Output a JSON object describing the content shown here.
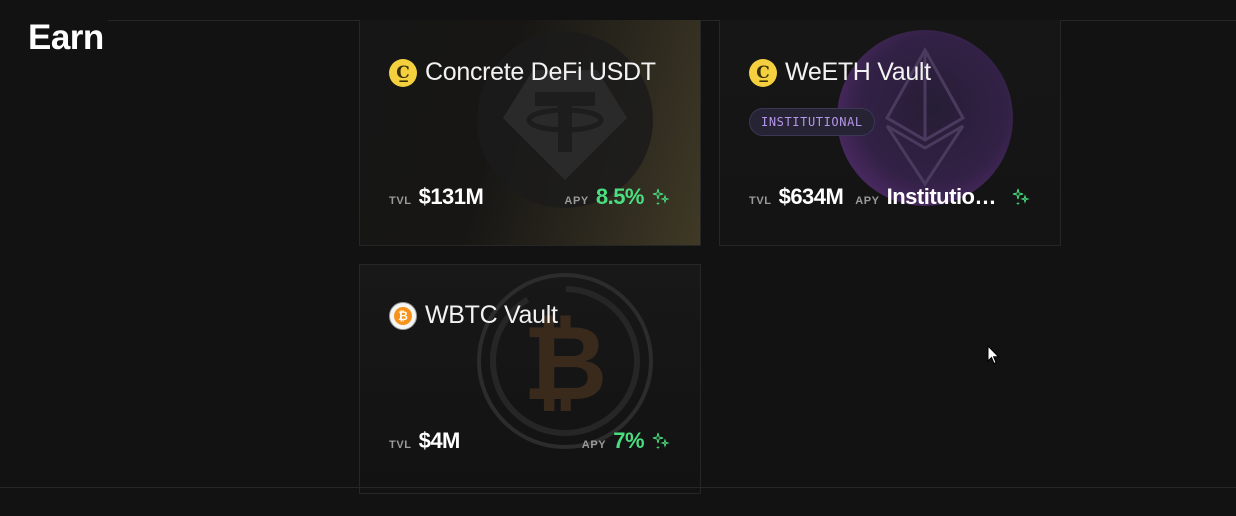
{
  "page": {
    "title": "Earn"
  },
  "vaults": [
    {
      "name": "Concrete DeFi USDT",
      "coin_icon": "concrete-c-icon",
      "bg_logo": "tether-icon",
      "tvl_label": "TVL",
      "tvl": "$131M",
      "apy_label": "APY",
      "apy": "8.5%",
      "apy_color": "#4ade80"
    },
    {
      "name": "WeETH Vault",
      "coin_icon": "concrete-c-icon",
      "bg_logo": "ethereum-icon",
      "badge": "INSTITUTIONAL",
      "tvl_label": "TVL",
      "tvl": "$634M",
      "apy_label": "APY",
      "apy": "Institutio…",
      "apy_color": "#ffffff"
    },
    {
      "name": "WBTC Vault",
      "coin_icon": "bitcoin-icon",
      "bg_logo": "bitcoin-icon",
      "tvl_label": "TVL",
      "tvl": "$4M",
      "apy_label": "APY",
      "apy": "7%",
      "apy_color": "#4ade80"
    }
  ],
  "colors": {
    "background": "#121212",
    "accent_green": "#4ade80",
    "badge_purple": "#b596e8",
    "coin_yellow": "#f4d03f"
  },
  "coin_glyphs": {
    "concrete": "C̲",
    "bitcoin": "₿"
  }
}
